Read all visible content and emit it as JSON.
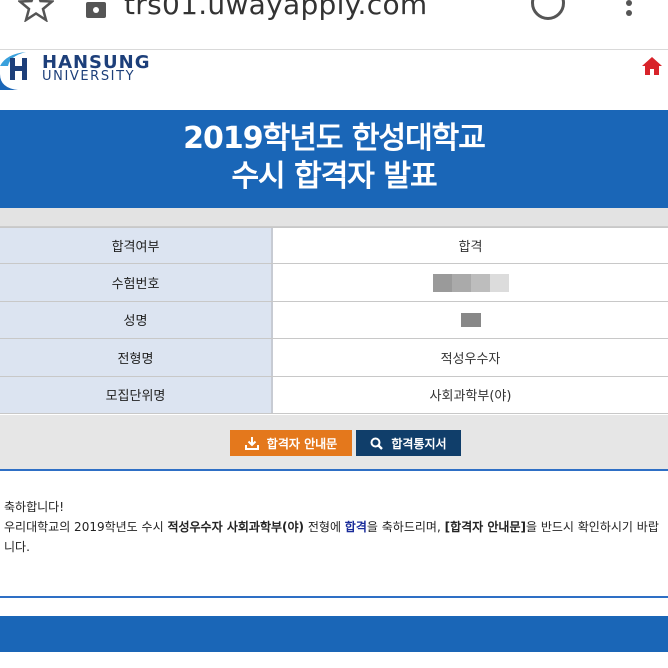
{
  "browser": {
    "url": "trs01.uwayapply.com"
  },
  "header": {
    "logo_line1": "HANSUNG",
    "logo_line2": "UNIVERSITY",
    "home_icon": "home-icon",
    "brand_color": "#1d3f7a",
    "home_color": "#d8232a"
  },
  "banner": {
    "line1": "2019학년도 한성대학교",
    "line2": "수시 합격자 발표",
    "color": "#1a66b7"
  },
  "results": [
    {
      "label": "합격여부",
      "value": "합격"
    },
    {
      "label": "수험번호",
      "value": ""
    },
    {
      "label": "성명",
      "value": ""
    },
    {
      "label": "전형명",
      "value": "적성우수자"
    },
    {
      "label": "모집단위명",
      "value": "사회과학부(야)"
    }
  ],
  "buttons": {
    "guide_label": "합격자 안내문",
    "guide_icon": "download-icon",
    "guide_color": "#e4781c",
    "notice_label": "합격통지서",
    "notice_icon": "search-icon",
    "notice_color": "#103e6a"
  },
  "message": {
    "greeting": "축하합니다!",
    "p1": "우리대학교의 2019학년도 수시 ",
    "track": "적성우수자",
    "space": " ",
    "dept": "사회과학부(야)",
    "p2": " 전형에 ",
    "result": "합격",
    "p3": "을 축하드리며, ",
    "guide_ref": "[합격자 안내문]",
    "p4": "을 반드시 확인하시기 바랍니다."
  }
}
